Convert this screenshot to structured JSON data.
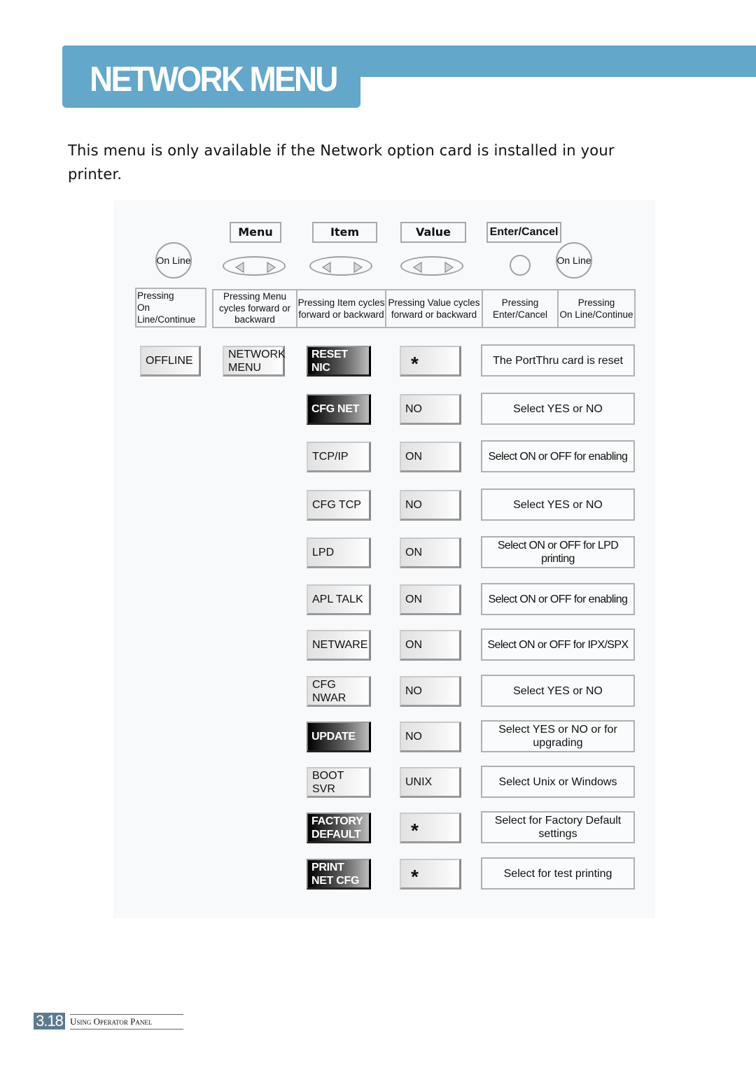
{
  "header": {
    "title": "NETWORK MENU",
    "accent_color": "#63a7cb"
  },
  "intro": "This menu is only available if the Network option card is installed in your printer.",
  "panel": {
    "key_labels": {
      "menu": "Menu",
      "item": "Item",
      "value": "Value",
      "enter_cancel": "Enter/Cancel"
    },
    "buttons": {
      "online_left": "On Line",
      "online_right": "On Line"
    },
    "descriptions": [
      "Pressing\nOn Line/Continue",
      "Pressing Menu\ncycles forward or\nbackward",
      "Pressing Item cycles\nforward or backward",
      "Pressing Value cycles\nforward or backward",
      "Pressing\nEnter/Cancel",
      "Pressing\nOn Line/Continue"
    ],
    "start_states": {
      "offline": "OFFLINE",
      "menu": "NETWORK\nMENU"
    },
    "rows": [
      {
        "item": "RESET NIC",
        "item_style": "dark",
        "value": "*",
        "description": "The PortThru card is reset"
      },
      {
        "item": "CFG NET",
        "item_style": "dark",
        "value": "NO",
        "description": "Select YES or NO"
      },
      {
        "item": "TCP/IP",
        "item_style": "light",
        "value": "ON",
        "description": "Select ON or OFF for enabling"
      },
      {
        "item": "CFG TCP",
        "item_style": "light",
        "value": "NO",
        "description": "Select YES or NO"
      },
      {
        "item": "LPD",
        "item_style": "light",
        "value": "ON",
        "description": "Select ON or OFF for LPD printing"
      },
      {
        "item": "APL TALK",
        "item_style": "light",
        "value": "ON",
        "description": "Select ON or OFF for enabling"
      },
      {
        "item": "NETWARE",
        "item_style": "light",
        "value": "ON",
        "description": "Select ON or OFF for IPX/SPX"
      },
      {
        "item": "CFG NWAR",
        "item_style": "light",
        "value": "NO",
        "description": "Select YES or NO"
      },
      {
        "item": "UPDATE",
        "item_style": "dark",
        "value": "NO",
        "description": "Select YES or NO or for\nupgrading"
      },
      {
        "item": "BOOT SVR",
        "item_style": "light",
        "value": "UNIX",
        "description": "Select Unix or Windows"
      },
      {
        "item": "FACTORY\nDEFAULT",
        "item_style": "dark",
        "value": "*",
        "description": "Select for Factory Default\nsettings"
      },
      {
        "item": "PRINT\nNET CFG",
        "item_style": "dark",
        "value": "*",
        "description": "Select for test printing"
      }
    ]
  },
  "footer": {
    "page_number": "3.18",
    "section": "Using Operator Panel"
  }
}
